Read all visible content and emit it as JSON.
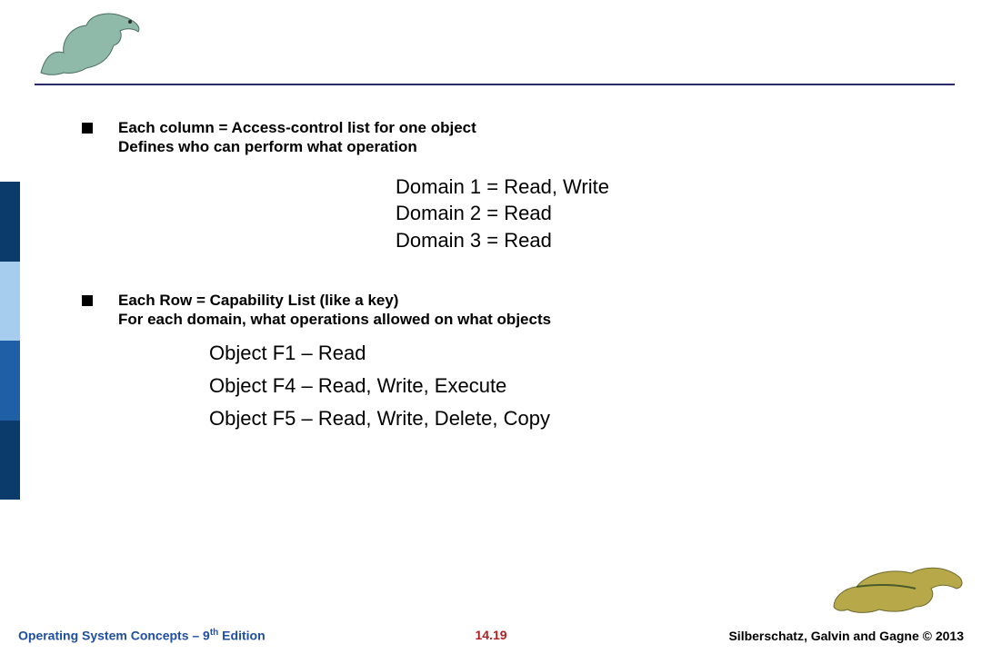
{
  "bullet1": {
    "line1": "Each column = Access-control list for one object",
    "line2": "Defines who can perform what operation"
  },
  "domains": {
    "d1": "Domain 1 = Read, Write",
    "d2": "Domain 2 = Read",
    "d3": "Domain 3 = Read"
  },
  "bullet2": {
    "line1": "Each Row = Capability List (like a key)",
    "line2": "For each domain, what operations allowed on what objects"
  },
  "objects": {
    "o1": "Object F1 – Read",
    "o2": "Object F4 – Read, Write, Execute",
    "o3": "Object F5 – Read, Write, Delete, Copy"
  },
  "footer": {
    "left_prefix": "Operating System Concepts – 9",
    "left_suffix_sup": "th",
    "left_tail": " Edition",
    "center": "14.19",
    "right": "Silberschatz, Galvin and Gagne © 2013"
  }
}
